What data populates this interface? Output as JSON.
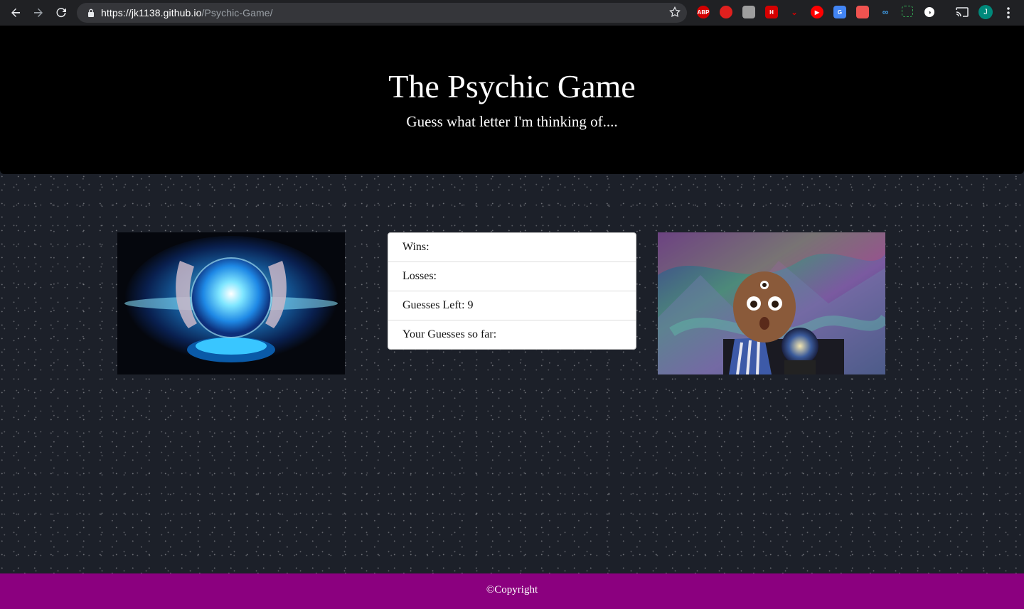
{
  "browser": {
    "url_host": "https://jk1138.github.io",
    "url_path": "/Psychic-Game/",
    "extensions": [
      "ABP",
      "h",
      "9",
      "K",
      "H",
      "v",
      "▶",
      "G",
      "▶",
      "••",
      "[ ]",
      "◑"
    ],
    "avatar_letter": "J"
  },
  "header": {
    "title": "The Psychic Game",
    "subtitle": "Guess what letter I'm thinking of...."
  },
  "scoreboard": {
    "wins_label": "Wins:",
    "losses_label": "Losses:",
    "guesses_left_label": "Guesses Left: 9",
    "guesses_so_far_label": "Your Guesses so far:"
  },
  "footer": {
    "copyright": "©Copyright"
  },
  "colors": {
    "header_bg": "#000000",
    "footer_bg": "#8b007f",
    "page_bg": "#1c2029"
  }
}
